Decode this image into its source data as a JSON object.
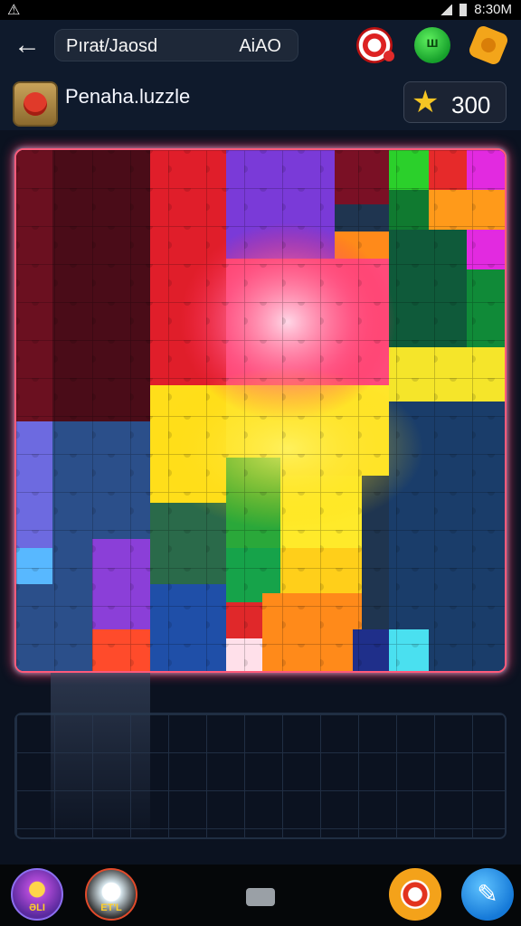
{
  "status_bar": {
    "warning": "⚠",
    "time": "8:30M"
  },
  "top_bar": {
    "back_icon": "arrow-left-icon",
    "search_text": "Pıraŧ/Jaosd",
    "search_right": "AiAO",
    "icons": [
      "target-icon",
      "green-badge-icon",
      "gear-icon"
    ],
    "green_badge_label": "ш"
  },
  "title_bar": {
    "title": "Penaha.luzzle",
    "score": "300",
    "star": "★"
  },
  "bottom_bar": {
    "gift_label": "ƏLI",
    "char_label": "ET'L",
    "tool_icon": "wrench-icon",
    "record_icon": "record-icon"
  }
}
